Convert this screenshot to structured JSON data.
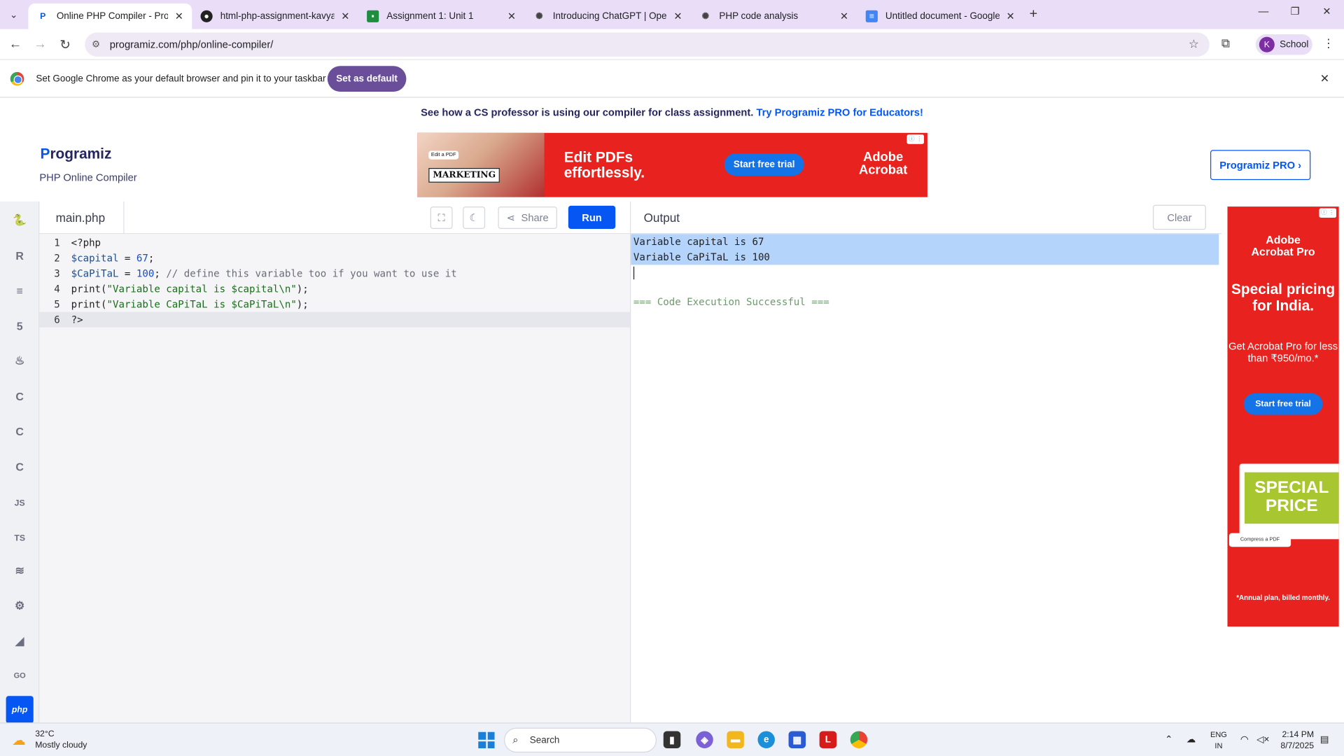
{
  "browser": {
    "tabs": [
      {
        "title": "Online PHP Compiler - Programiz",
        "favicon": "programiz-icon",
        "active": true
      },
      {
        "title": "html-php-assignment-kavyaP/P",
        "favicon": "github-icon",
        "active": false
      },
      {
        "title": "Assignment 1: Unit 1",
        "favicon": "classroom-icon",
        "active": false
      },
      {
        "title": "Introducing ChatGPT | OpenAI",
        "favicon": "openai-icon",
        "active": false
      },
      {
        "title": "PHP code analysis",
        "favicon": "openai-icon",
        "active": false
      },
      {
        "title": "Untitled document - Google Do",
        "favicon": "docs-icon",
        "active": false
      }
    ],
    "url": "programiz.com/php/online-compiler/",
    "profile_initial": "K",
    "profile_label": "School"
  },
  "infobar": {
    "message": "Set Google Chrome as your default browser and pin it to your taskbar",
    "button": "Set as default"
  },
  "promo": {
    "text": "See how a CS professor is using our compiler for class assignment. ",
    "link": "Try Programiz PRO for Educators!"
  },
  "header": {
    "logo_first": "P",
    "logo_rest": "rogramiz",
    "subtitle": "PHP Online Compiler",
    "pro_button": "Programiz PRO ›"
  },
  "ad_top": {
    "badge": "Edit a PDF",
    "marketing": "MARKETING",
    "headline_1": "Edit PDFs",
    "headline_2": "effortlessly.",
    "cta": "Start free trial",
    "brand_1": "Adobe",
    "brand_2": "Acrobat"
  },
  "rail": {
    "languages": [
      {
        "name": "python",
        "glyph": "🐍"
      },
      {
        "name": "r",
        "glyph": "R"
      },
      {
        "name": "sql",
        "glyph": "≡"
      },
      {
        "name": "html",
        "glyph": "5"
      },
      {
        "name": "java",
        "glyph": "♨"
      },
      {
        "name": "c",
        "glyph": "C"
      },
      {
        "name": "cpp",
        "glyph": "C"
      },
      {
        "name": "csharp",
        "glyph": "C"
      },
      {
        "name": "javascript",
        "glyph": "JS"
      },
      {
        "name": "typescript",
        "glyph": "TS"
      },
      {
        "name": "swift",
        "glyph": "≋"
      },
      {
        "name": "rust",
        "glyph": "⚙"
      },
      {
        "name": "kotlin",
        "glyph": "◢"
      },
      {
        "name": "go",
        "glyph": "GO"
      },
      {
        "name": "php",
        "glyph": "php",
        "active": true
      }
    ]
  },
  "editor": {
    "filename": "main.php",
    "share_label": "Share",
    "run_label": "Run",
    "lines": [
      {
        "n": "1",
        "segments": [
          {
            "t": "<?php",
            "c": ""
          }
        ]
      },
      {
        "n": "2",
        "segments": [
          {
            "t": "$capital",
            "c": "c-var"
          },
          {
            "t": " = ",
            "c": ""
          },
          {
            "t": "67",
            "c": "c-num"
          },
          {
            "t": ";",
            "c": ""
          }
        ]
      },
      {
        "n": "3",
        "segments": [
          {
            "t": "$CaPiTaL",
            "c": "c-var"
          },
          {
            "t": " = ",
            "c": ""
          },
          {
            "t": "100",
            "c": "c-num"
          },
          {
            "t": "; ",
            "c": ""
          },
          {
            "t": "// define this variable too if you want to use it",
            "c": "c-cmt"
          }
        ]
      },
      {
        "n": "4",
        "segments": [
          {
            "t": "print(",
            "c": ""
          },
          {
            "t": "\"Variable capital is $capital\\n\"",
            "c": "c-str"
          },
          {
            "t": ");",
            "c": ""
          }
        ]
      },
      {
        "n": "5",
        "segments": [
          {
            "t": "print(",
            "c": ""
          },
          {
            "t": "\"Variable CaPiTaL is $CaPiTaL\\n\"",
            "c": "c-str"
          },
          {
            "t": ");",
            "c": ""
          }
        ]
      },
      {
        "n": "6",
        "segments": [
          {
            "t": "?>",
            "c": ""
          }
        ],
        "current": true
      }
    ]
  },
  "output": {
    "title": "Output",
    "clear_label": "Clear",
    "lines": [
      "Variable capital is 67",
      "Variable CaPiTaL is 100"
    ],
    "status": "=== Code Execution Successful ==="
  },
  "ad_right": {
    "brand_1": "Adobe",
    "brand_2": "Acrobat Pro",
    "headline": "Special pricing for India.",
    "subline": "Get Acrobat Pro for less than ₹950/mo.*",
    "cta": "Start free trial",
    "tag": "SPECIAL PRICE",
    "compress": "Compress a PDF",
    "fine": "*Annual plan, billed monthly."
  },
  "taskbar": {
    "temp": "32°C",
    "weather": "Mostly cloudy",
    "search_placeholder": "Search",
    "lang_1": "ENG",
    "lang_2": "IN",
    "time": "2:14 PM",
    "date": "8/7/2025"
  },
  "colors": {
    "brand_blue": "#0556f3",
    "ad_red": "#e8231f",
    "selection": "#b5d4fb"
  }
}
